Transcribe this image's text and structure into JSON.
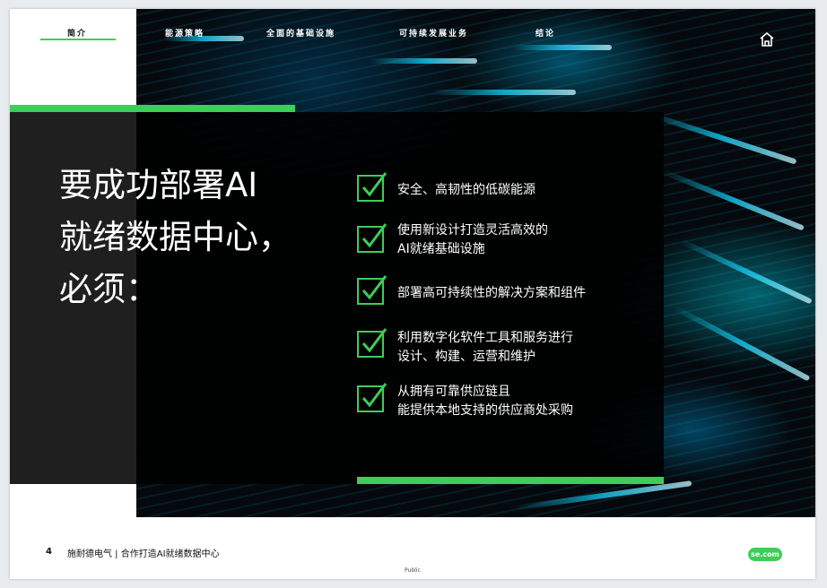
{
  "nav": {
    "items": [
      {
        "label": "简介",
        "active": true
      },
      {
        "label": "能源策略",
        "active": false
      },
      {
        "label": "全面的基础设施",
        "active": false
      },
      {
        "label": "可持续发展业务",
        "active": false
      },
      {
        "label": "结论",
        "active": false
      }
    ],
    "home_icon": "home-icon"
  },
  "hero": {
    "title_lines": [
      "要成功部署AI",
      "就绪数据中心，",
      "必须："
    ],
    "checklist": [
      {
        "lines": [
          "安全、高韧性的低碳能源"
        ]
      },
      {
        "lines": [
          "使用新设计打造灵活高效的",
          "AI就绪基础设施"
        ]
      },
      {
        "lines": [
          "部署高可持续性的解决方案和组件"
        ]
      },
      {
        "lines": [
          "利用数字化软件工具和服务进行",
          "设计、构建、运营和维护"
        ]
      },
      {
        "lines": [
          "从拥有可靠供应链且",
          "能提供本地支持的供应商处采购"
        ]
      }
    ]
  },
  "footer": {
    "page_number": "4",
    "text": "施耐德电气 | 合作打造AI就绪数据中心",
    "classification": "Public",
    "site_badge": "se.com"
  },
  "colors": {
    "accent_green": "#3dcd58",
    "panel_dark": "#000000",
    "text_light": "#ffffff"
  }
}
